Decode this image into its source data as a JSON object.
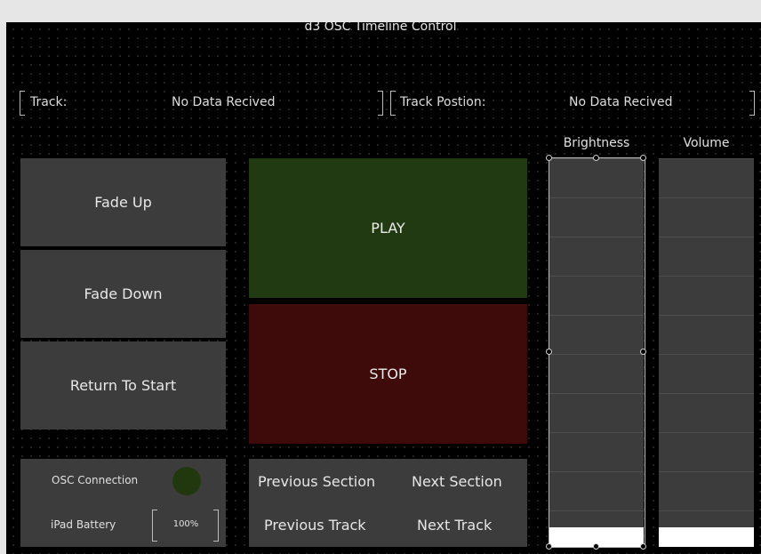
{
  "app": {
    "title": "d3 OSC Timeline Control"
  },
  "info": {
    "track_label": "Track:",
    "track_value": "No Data Recived",
    "position_label": "Track Postion:",
    "position_value": "No Data Recived"
  },
  "buttons": {
    "fade_up": "Fade Up",
    "fade_down": "Fade Down",
    "return_to_start": "Return To Start",
    "play": "PLAY",
    "stop": "STOP",
    "previous_section": "Previous Section",
    "next_section": "Next Section",
    "previous_track": "Previous Track",
    "next_track": "Next Track"
  },
  "status": {
    "osc_label": "OSC Connection",
    "osc_led_color": "#21380f",
    "battery_label": "iPad Battery",
    "battery_value": "100%"
  },
  "faders": {
    "brightness": {
      "label": "Brightness",
      "level": 0.05
    },
    "volume": {
      "label": "Volume",
      "level": 0.05
    }
  },
  "colors": {
    "play_bg": "#213a12",
    "stop_bg": "#3e0b0a",
    "button_bg": "#3c3c3c",
    "canvas_bg": "#000000"
  }
}
